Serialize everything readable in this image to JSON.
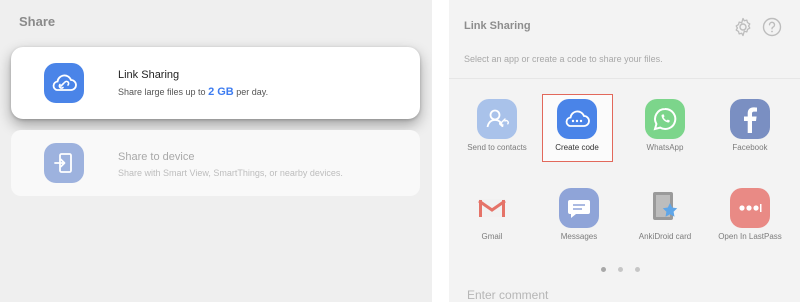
{
  "left": {
    "title": "Share",
    "link_sharing": {
      "title": "Link Sharing",
      "sub_prefix": "Share large files up to ",
      "sub_size": "2 GB",
      "sub_suffix": " per day."
    },
    "share_device": {
      "title": "Share to device",
      "sub": "Share with Smart View, SmartThings, or nearby devices."
    }
  },
  "right": {
    "title": "Link Sharing",
    "subtitle": "Select an app or create a code to share your files.",
    "apps": [
      {
        "label": "Send to contacts",
        "icon": "contacts-icon"
      },
      {
        "label": "Create code",
        "icon": "create-code-icon"
      },
      {
        "label": "WhatsApp",
        "icon": "whatsapp-icon"
      },
      {
        "label": "Facebook",
        "icon": "facebook-icon"
      },
      {
        "label": "Gmail",
        "icon": "gmail-icon"
      },
      {
        "label": "Messages",
        "icon": "messages-icon"
      },
      {
        "label": "AnkiDroid card",
        "icon": "ankidroid-icon"
      },
      {
        "label": "Open In LastPass",
        "icon": "lastpass-icon"
      }
    ],
    "comment_placeholder": "Enter comment"
  },
  "colors": {
    "link_sharing_icon": "#4a84e8",
    "share_device_icon": "#9db2de",
    "highlight_border": "#e2685b",
    "gb_accent": "#3d7cf0"
  }
}
